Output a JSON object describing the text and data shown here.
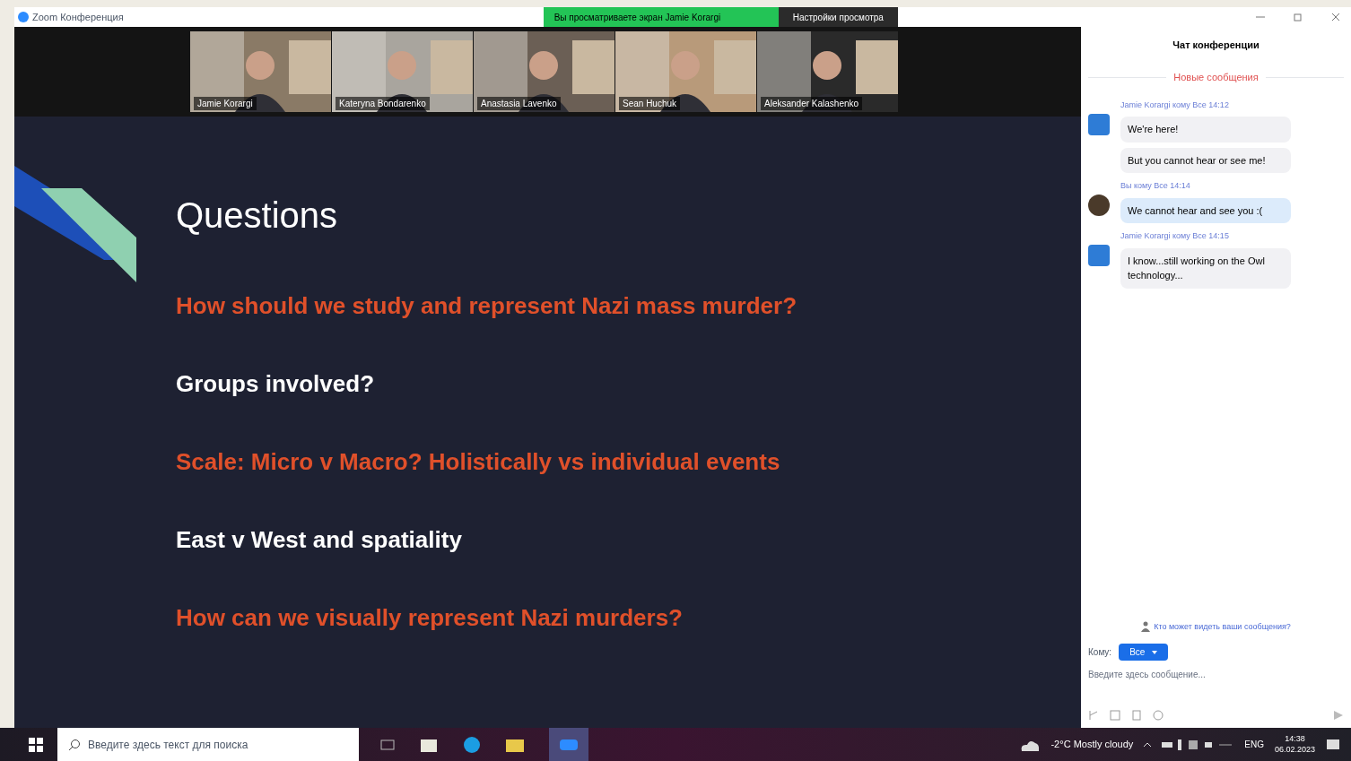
{
  "window": {
    "title": "Zoom Конференция",
    "share_banner": "Вы просматриваете экран Jamie Korargi",
    "view_options": "Настройки просмотра"
  },
  "participants": [
    {
      "name": "Jamie Korargi"
    },
    {
      "name": "Kateryna Bondarenko"
    },
    {
      "name": "Anastasia Lavenko"
    },
    {
      "name": "Sean Huchuk"
    },
    {
      "name": "Aleksander Kalashenko"
    }
  ],
  "slide": {
    "title": "Questions",
    "items": [
      {
        "text": "How should we study and represent Nazi mass murder?",
        "kind": "highlight"
      },
      {
        "text": "Groups involved?",
        "kind": "plain"
      },
      {
        "text": "Scale: Micro v Macro? Holistically vs individual events",
        "kind": "highlight"
      },
      {
        "text": "East v West and spatiality",
        "kind": "plain"
      },
      {
        "text": "How can we visually represent Nazi murders?",
        "kind": "highlight"
      }
    ]
  },
  "chat": {
    "title": "Чат конференции",
    "new_messages": "Новые сообщения",
    "messages": [
      {
        "sender": "Jamie Korargi кому Все 14:12",
        "kind": "initial",
        "texts": [
          "We're here!",
          "But you cannot hear or see me!"
        ],
        "own": false
      },
      {
        "sender": "Вы кому Все 14:14",
        "texts": [
          "We cannot hear and see you :("
        ],
        "own": true
      },
      {
        "sender": "Jamie Korargi кому Все 14:15",
        "kind": "initial",
        "texts": [
          "I know...still working on the Owl technology..."
        ],
        "own": false
      }
    ],
    "visibility": "Кто может видеть ваши сообщения?",
    "to_label": "Кому:",
    "recipient": "Все",
    "placeholder": "Введите здесь сообщение..."
  },
  "taskbar": {
    "search_placeholder": "Введите здесь текст для поиска",
    "weather": "-2°C Mostly cloudy",
    "language": "ENG",
    "time": "14:38",
    "date": "06.02.2023"
  }
}
